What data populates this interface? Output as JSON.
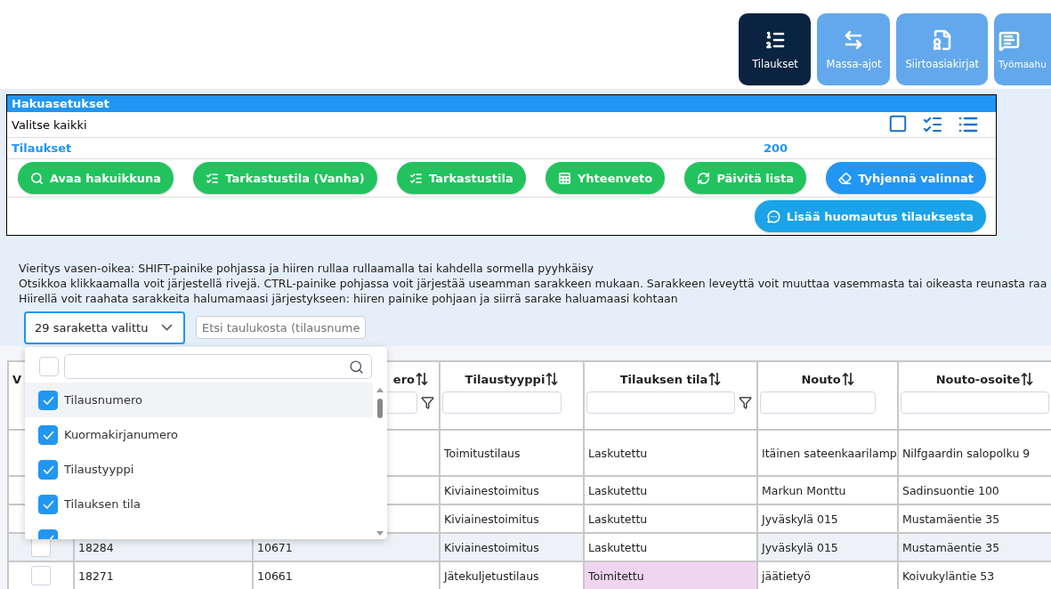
{
  "nav": [
    {
      "label": "Tilaukset",
      "selected": true
    },
    {
      "label": "Massa-ajot",
      "selected": false
    },
    {
      "label": "Siirtoasiakirjat",
      "selected": false
    },
    {
      "label": "Työmaahu",
      "selected": false
    }
  ],
  "panel": {
    "title": "Hakuasetukset",
    "select_all_label": "Valitse kaikki",
    "orders_label": "Tilaukset",
    "orders_count": "200",
    "buttons": [
      {
        "label": "Avaa hakuikkuna",
        "kind": "green"
      },
      {
        "label": "Tarkastustila (Vanha)",
        "kind": "green"
      },
      {
        "label": "Tarkastustila",
        "kind": "green"
      },
      {
        "label": "Yhteenveto",
        "kind": "green"
      },
      {
        "label": "Päivitä lista",
        "kind": "green"
      },
      {
        "label": "Tyhjennä valinnat",
        "kind": "blue"
      },
      {
        "label": "Lisää huomautus tilauksesta",
        "kind": "cyan"
      }
    ]
  },
  "help_lines": [
    "Vieritys vasen-oikea: SHIFT-painike pohjassa ja hiiren rullaa rullaamalla tai kahdella sormella pyyhkäisy",
    "Otsikkoa klikkaamalla voit järjestellä rivejä. CTRL-painike pohjassa voit järjestää useamman sarakkeen mukaan. Sarakkeen leveyttä voit muuttaa vasemmasta tai oikeasta reunasta raa",
    "Hiirellä voit raahata sarakkeita halumamaasi järjestykseen: hiiren painike pohjaan ja siirrä sarake haluamaasi kohtaan"
  ],
  "column_select": {
    "value": "29 saraketta valittu",
    "expanded": true,
    "menu": {
      "select_all_checked": false,
      "items": [
        {
          "label": "Tilausnumero",
          "checked": true,
          "selected": true
        },
        {
          "label": "Kuormakirjanumero",
          "checked": true,
          "selected": false
        },
        {
          "label": "Tilaustyyppi",
          "checked": true,
          "selected": false
        },
        {
          "label": "Tilauksen tila",
          "checked": true,
          "selected": false
        },
        {
          "checked": true,
          "selected": false
        }
      ]
    }
  },
  "table_search": {
    "placeholder": "Etsi taulukosta (tilausnume"
  },
  "table": {
    "columns": [
      {
        "title": "V"
      },
      {},
      {
        "title": "ero",
        "sortable": true,
        "filter_field": true,
        "filter_icon": true
      },
      {
        "title": "Tilaustyyppi",
        "sortable": true,
        "filter_field": true
      },
      {
        "title": "Tilauksen tila",
        "sortable": true,
        "filter_field": true,
        "filter_icon": true
      },
      {
        "title": "Nouto",
        "sortable": true,
        "filter_field": true
      },
      {
        "title": "Nouto-osoite",
        "sortable": true,
        "filter_field": true
      }
    ],
    "rows": [
      {
        "highlighted": false,
        "tall": true,
        "type": "Toimitustilaus",
        "status": {
          "text": "Laskutettu",
          "color": "#ffffff"
        },
        "pickup": "Itäinen sateenkaarilamp",
        "pickup_address": "Nilfgaardin salopolku 9"
      },
      {
        "highlighted": false,
        "type": "Kiviainestoimitus",
        "status": {
          "text": "Laskutettu",
          "color": "#ffffff"
        },
        "pickup": "Markun Monttu",
        "pickup_address": "Sadinsuontie 100"
      },
      {
        "highlighted": false,
        "type": "Kiviainestoimitus",
        "status": {
          "text": "Laskutettu",
          "color": "#ffffff"
        },
        "pickup": "Jyväskylä 015",
        "pickup_address": "Mustamäentie 35"
      },
      {
        "highlighted": true,
        "checked": false,
        "order_no": "18284",
        "waybill_no": "10671",
        "type": "Kiviainestoimitus",
        "status": {
          "text": "Laskutettu",
          "color": "#ffffff"
        },
        "pickup": "Jyväskylä 015",
        "pickup_address": "Mustamäentie 35"
      },
      {
        "highlighted": false,
        "checked": false,
        "order_no": "18271",
        "waybill_no": "10661",
        "type": "Jätekuljetustilaus",
        "status": {
          "text": "Toimitettu",
          "color": "#f0d5f1"
        },
        "pickup": "jäätietyö",
        "pickup_address": "Koivukyläntie 53"
      }
    ]
  }
}
